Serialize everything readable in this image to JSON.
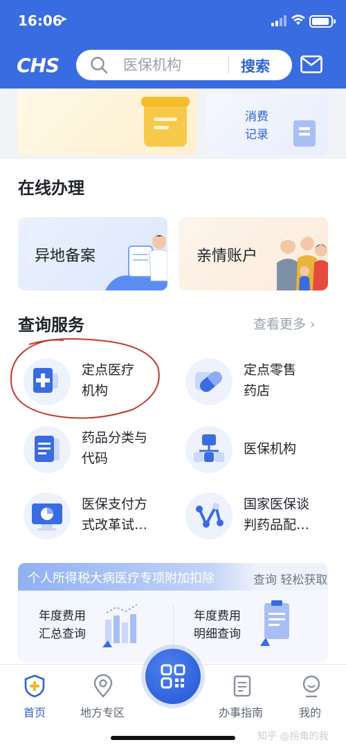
{
  "status_bar": {
    "time": "16:06"
  },
  "header": {
    "logo": "CHS",
    "search_placeholder": "医保机构",
    "search_button": "搜索",
    "icons": {
      "search": "search-icon",
      "mail": "mail-icon"
    }
  },
  "banners": {
    "consumption_record": "消费\n记录"
  },
  "online": {
    "title": "在线办理",
    "cards": [
      {
        "label": "异地备案"
      },
      {
        "label": "亲情账户"
      }
    ]
  },
  "query": {
    "title": "查询服务",
    "more": "查看更多 ›",
    "items": [
      {
        "label": "定点医疗\n机构",
        "icon": "medical-kit-icon"
      },
      {
        "label": "定点零售\n药店",
        "icon": "pill-icon"
      },
      {
        "label": "药品分类与\n代码",
        "icon": "document-icon"
      },
      {
        "label": "医保机构",
        "icon": "org-chart-icon"
      },
      {
        "label": "医保支付方\n式改革试…",
        "icon": "monitor-chart-icon"
      },
      {
        "label": "国家医保谈\n判药品配…",
        "icon": "network-icon"
      }
    ]
  },
  "tax": {
    "title": "个人所得税大病医疗专项附加扣除",
    "subtitle": "查询 轻松获取",
    "items": [
      {
        "label": "年度费用\n汇总查询"
      },
      {
        "label": "年度费用\n明细查询"
      }
    ]
  },
  "tabbar": {
    "tabs": [
      {
        "label": "首页",
        "icon": "shield-plus-icon",
        "active": true
      },
      {
        "label": "地方专区",
        "icon": "location-pin-icon",
        "active": false
      },
      {
        "label": "办事指南",
        "icon": "guide-doc-icon",
        "active": false
      },
      {
        "label": "我的",
        "icon": "profile-icon",
        "active": false
      }
    ],
    "center": "qr-code-icon"
  },
  "watermark": "知乎 @拐角的我",
  "colors": {
    "primary": "#3a6ce1",
    "accent": "#2f62da",
    "highlight_circle": "#c0392b"
  }
}
